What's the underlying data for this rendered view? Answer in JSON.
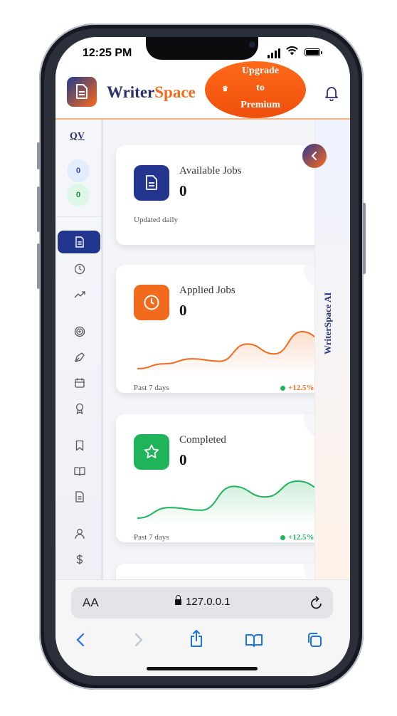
{
  "status": {
    "time": "12:25 PM"
  },
  "header": {
    "brand_part1": "Writer",
    "brand_part2": "Space",
    "upgrade_lines": [
      "Upgrade",
      "to",
      "Premium"
    ]
  },
  "sidebar": {
    "logo_text": "QV",
    "badges": [
      "0",
      "0"
    ],
    "items": [
      {
        "icon": "document-icon",
        "active": true
      },
      {
        "icon": "clock-icon"
      },
      {
        "icon": "trending-up-icon"
      },
      {
        "icon": "target-icon"
      },
      {
        "icon": "pen-icon"
      },
      {
        "icon": "calendar-icon"
      },
      {
        "icon": "award-icon"
      },
      {
        "icon": "bookmark-icon"
      },
      {
        "icon": "book-icon"
      },
      {
        "icon": "file-text-icon"
      },
      {
        "icon": "user-icon"
      },
      {
        "icon": "dollar-icon"
      }
    ]
  },
  "cards": [
    {
      "title": "Available Jobs",
      "value": "0",
      "note": "Updated daily",
      "icon": "document-icon",
      "color": "#23358f"
    },
    {
      "title": "Applied Jobs",
      "value": "0",
      "note": "Past 7 days",
      "trend": "+12.5%",
      "icon": "clock-icon",
      "color": "#f26b1d",
      "series": [
        10,
        12,
        14,
        13,
        20,
        16,
        25,
        20
      ]
    },
    {
      "title": "Completed",
      "value": "0",
      "note": "Past 7 days",
      "trend": "+12.5%",
      "icon": "star-icon",
      "color": "#1fb45a",
      "series": [
        10,
        14,
        13,
        22,
        18,
        24,
        20
      ]
    }
  ],
  "ai_panel": {
    "label": "WriterSpace AI"
  },
  "safari": {
    "aa_label": "AA",
    "url": "127.0.0.1"
  },
  "colors": {
    "primary": "#23358f",
    "accent": "#f26b1d",
    "success": "#1fb45a"
  }
}
